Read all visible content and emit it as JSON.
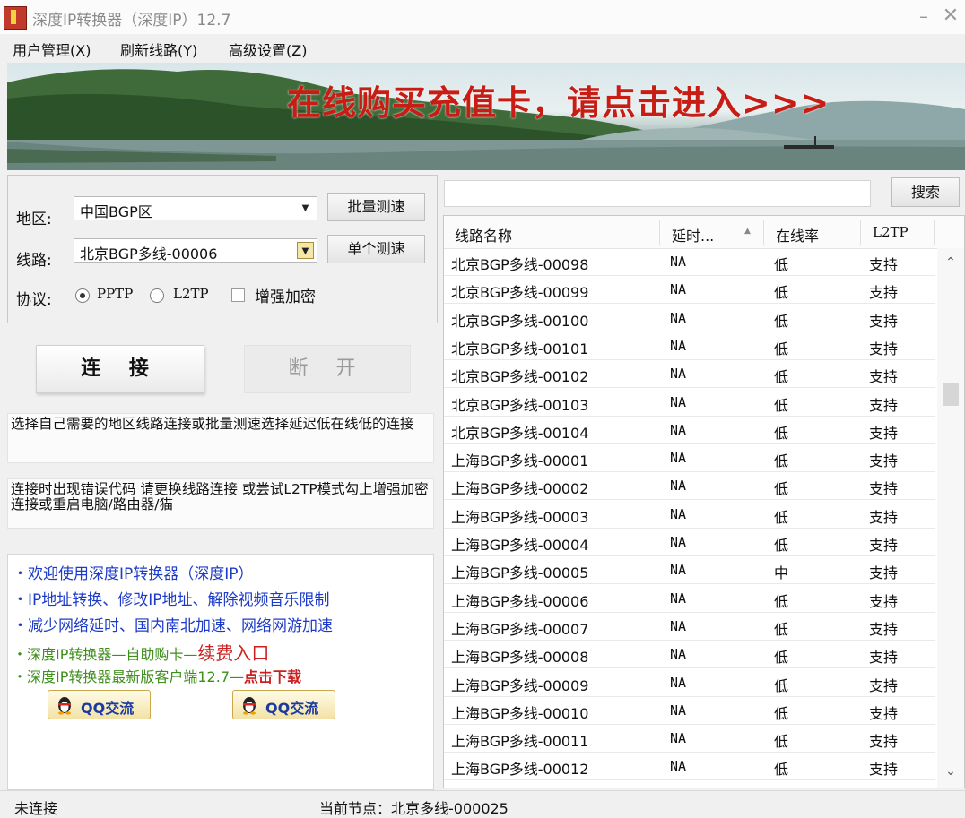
{
  "window": {
    "title": "深度IP转换器（深度IP）12.7",
    "minimize_glyph": "–",
    "close_glyph": "✕"
  },
  "menu": [
    "用户管理(X)",
    "刷新线路(Y)",
    "高级设置(Z)"
  ],
  "banner": {
    "text": "在线购买充值卡，请点击进入>>>"
  },
  "form": {
    "region_label": "地区:",
    "region_value": "中国BGP区",
    "line_label": "线路:",
    "line_value": "北京BGP多线-00006",
    "protocol_label": "协议:",
    "protocol_options": [
      "PPTP",
      "L2TP"
    ],
    "protocol_selected": "PPTP",
    "encrypt_label": "增强加密",
    "batch_test_label": "批量测速",
    "single_test_label": "单个测速"
  },
  "actions": {
    "connect": "连 接",
    "disconnect": "断 开"
  },
  "tips": [
    "选择自己需要的地区线路连接或批量测速选择延迟低在线低的连接",
    "连接时出现错误代码 请更换线路连接 或尝试L2TP模式勾上增强加密连接或重启电脑/路由器/猫"
  ],
  "info": {
    "line1": "・欢迎使用深度IP转换器（深度IP）",
    "line2": "・IP地址转换、修改IP地址、解除视频音乐限制",
    "line3": "・减少网络延时、国内南北加速、网络网游加速",
    "line4_prefix": "・深度IP转换器—自助购卡—",
    "line4_link": "续费入口",
    "line5_prefix": "・深度IP转换器最新版客户端12.7—",
    "line5_link": "点击下载",
    "qq_button": "QQ交流"
  },
  "colors": {
    "blue": "#1d3bc9",
    "green": "#3f8f1c",
    "red": "#cc1f1f",
    "banner_red": "#c81d14"
  },
  "search": {
    "placeholder": "",
    "button": "搜索"
  },
  "table": {
    "headers": [
      "线路名称",
      "延时...",
      "在线率",
      "L2TP"
    ],
    "sort_indicator": "▲",
    "rows": [
      [
        "北京BGP多线-00098",
        "NA",
        "低",
        "支持"
      ],
      [
        "北京BGP多线-00099",
        "NA",
        "低",
        "支持"
      ],
      [
        "北京BGP多线-00100",
        "NA",
        "低",
        "支持"
      ],
      [
        "北京BGP多线-00101",
        "NA",
        "低",
        "支持"
      ],
      [
        "北京BGP多线-00102",
        "NA",
        "低",
        "支持"
      ],
      [
        "北京BGP多线-00103",
        "NA",
        "低",
        "支持"
      ],
      [
        "北京BGP多线-00104",
        "NA",
        "低",
        "支持"
      ],
      [
        "上海BGP多线-00001",
        "NA",
        "低",
        "支持"
      ],
      [
        "上海BGP多线-00002",
        "NA",
        "低",
        "支持"
      ],
      [
        "上海BGP多线-00003",
        "NA",
        "低",
        "支持"
      ],
      [
        "上海BGP多线-00004",
        "NA",
        "低",
        "支持"
      ],
      [
        "上海BGP多线-00005",
        "NA",
        "中",
        "支持"
      ],
      [
        "上海BGP多线-00006",
        "NA",
        "低",
        "支持"
      ],
      [
        "上海BGP多线-00007",
        "NA",
        "低",
        "支持"
      ],
      [
        "上海BGP多线-00008",
        "NA",
        "低",
        "支持"
      ],
      [
        "上海BGP多线-00009",
        "NA",
        "低",
        "支持"
      ],
      [
        "上海BGP多线-00010",
        "NA",
        "低",
        "支持"
      ],
      [
        "上海BGP多线-00011",
        "NA",
        "低",
        "支持"
      ],
      [
        "上海BGP多线-00012",
        "NA",
        "低",
        "支持"
      ]
    ]
  },
  "status": {
    "left": "未连接",
    "right": "当前节点：北京多线-000025"
  }
}
